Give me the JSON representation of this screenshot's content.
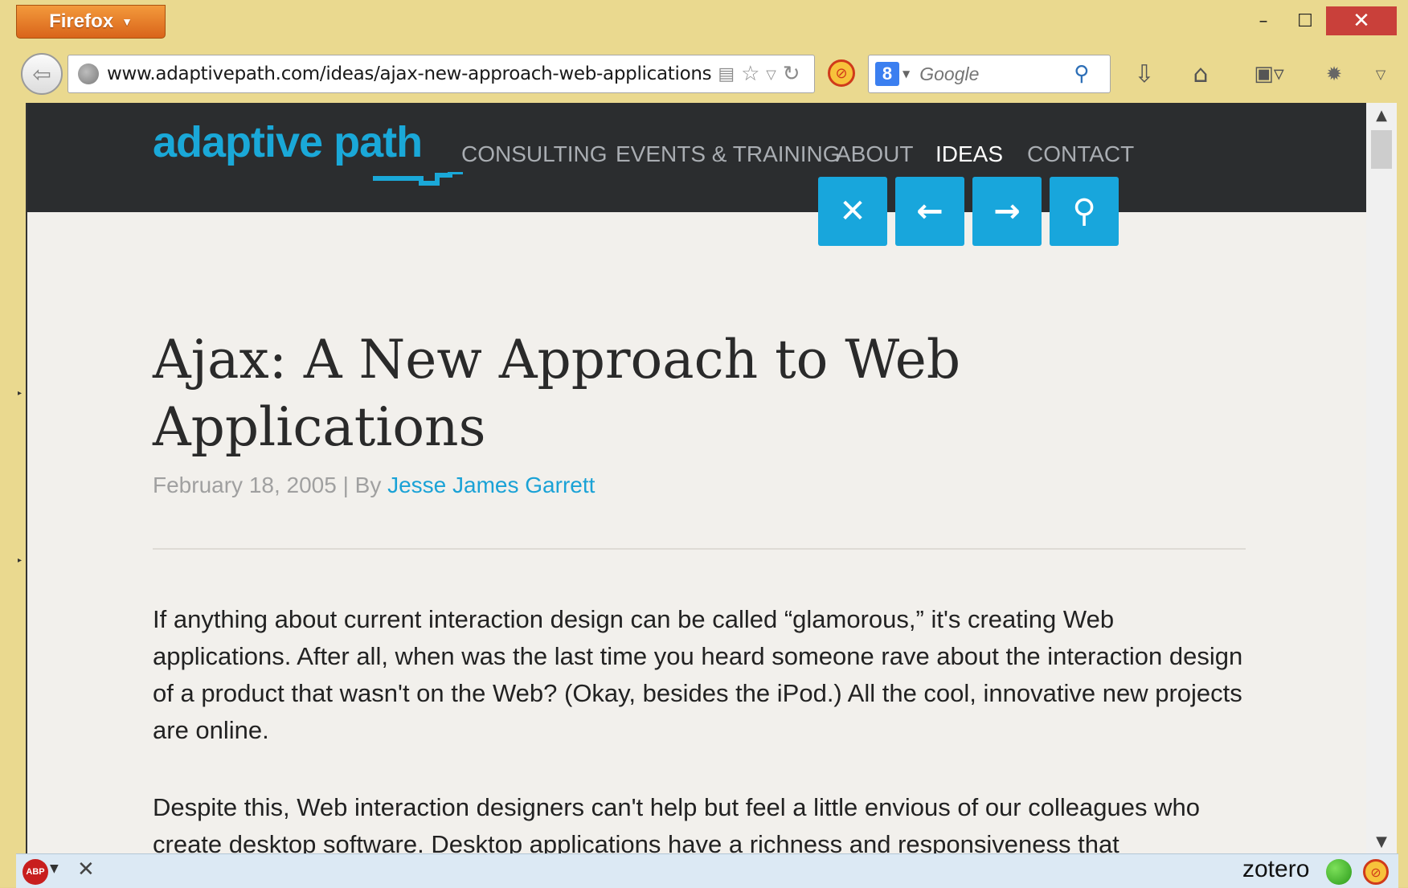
{
  "browser": {
    "menu_button_label": "Firefox",
    "window_controls": {
      "minimize": "–",
      "maximize": "☐",
      "close": "✕"
    },
    "url": "www.adaptivepath.com/ideas/ajax-new-approach-web-applications",
    "search": {
      "engine_icon": "8",
      "placeholder": "Google"
    },
    "toolbar_icons": [
      "reader-icon",
      "bookmark-star-icon",
      "dropdown-icon",
      "reload-icon",
      "blocker-icon",
      "download-icon",
      "home-icon",
      "bookmarks-icon",
      "addon-icon",
      "menu-icon"
    ]
  },
  "site": {
    "logo": "adaptive path",
    "nav": [
      {
        "label": "CONSULTING",
        "active": false
      },
      {
        "label": "EVENTS & TRAINING",
        "active": false
      },
      {
        "label": "ABOUT",
        "active": false
      },
      {
        "label": "IDEAS",
        "active": true
      },
      {
        "label": "CONTACT",
        "active": false
      }
    ],
    "action_buttons": [
      {
        "name": "close",
        "glyph": "✕"
      },
      {
        "name": "previous",
        "glyph": "←"
      },
      {
        "name": "next",
        "glyph": "→"
      },
      {
        "name": "search",
        "glyph": "⚲"
      }
    ],
    "accent_color": "#1aa8d8",
    "header_color": "#2b2d2f"
  },
  "article": {
    "title": "Ajax: A New Approach to Web Applications",
    "date": "February 18, 2005",
    "byline_separator": " | By ",
    "author": "Jesse James Garrett",
    "paragraphs": [
      "If anything about current interaction design can be called “glamorous,” it's creating Web applications. After all, when was the last time you heard someone rave about the interaction design of a product that wasn't on the Web? (Okay, besides the iPod.) All the cool, innovative new projects are online.",
      "Despite this, Web interaction designers can't help but feel a little envious of our colleagues who create desktop software. Desktop applications have a richness and responsiveness that"
    ]
  },
  "statusbar": {
    "abp_label": "ABP",
    "close_glyph": "✕",
    "zotero_label": "zotero"
  }
}
